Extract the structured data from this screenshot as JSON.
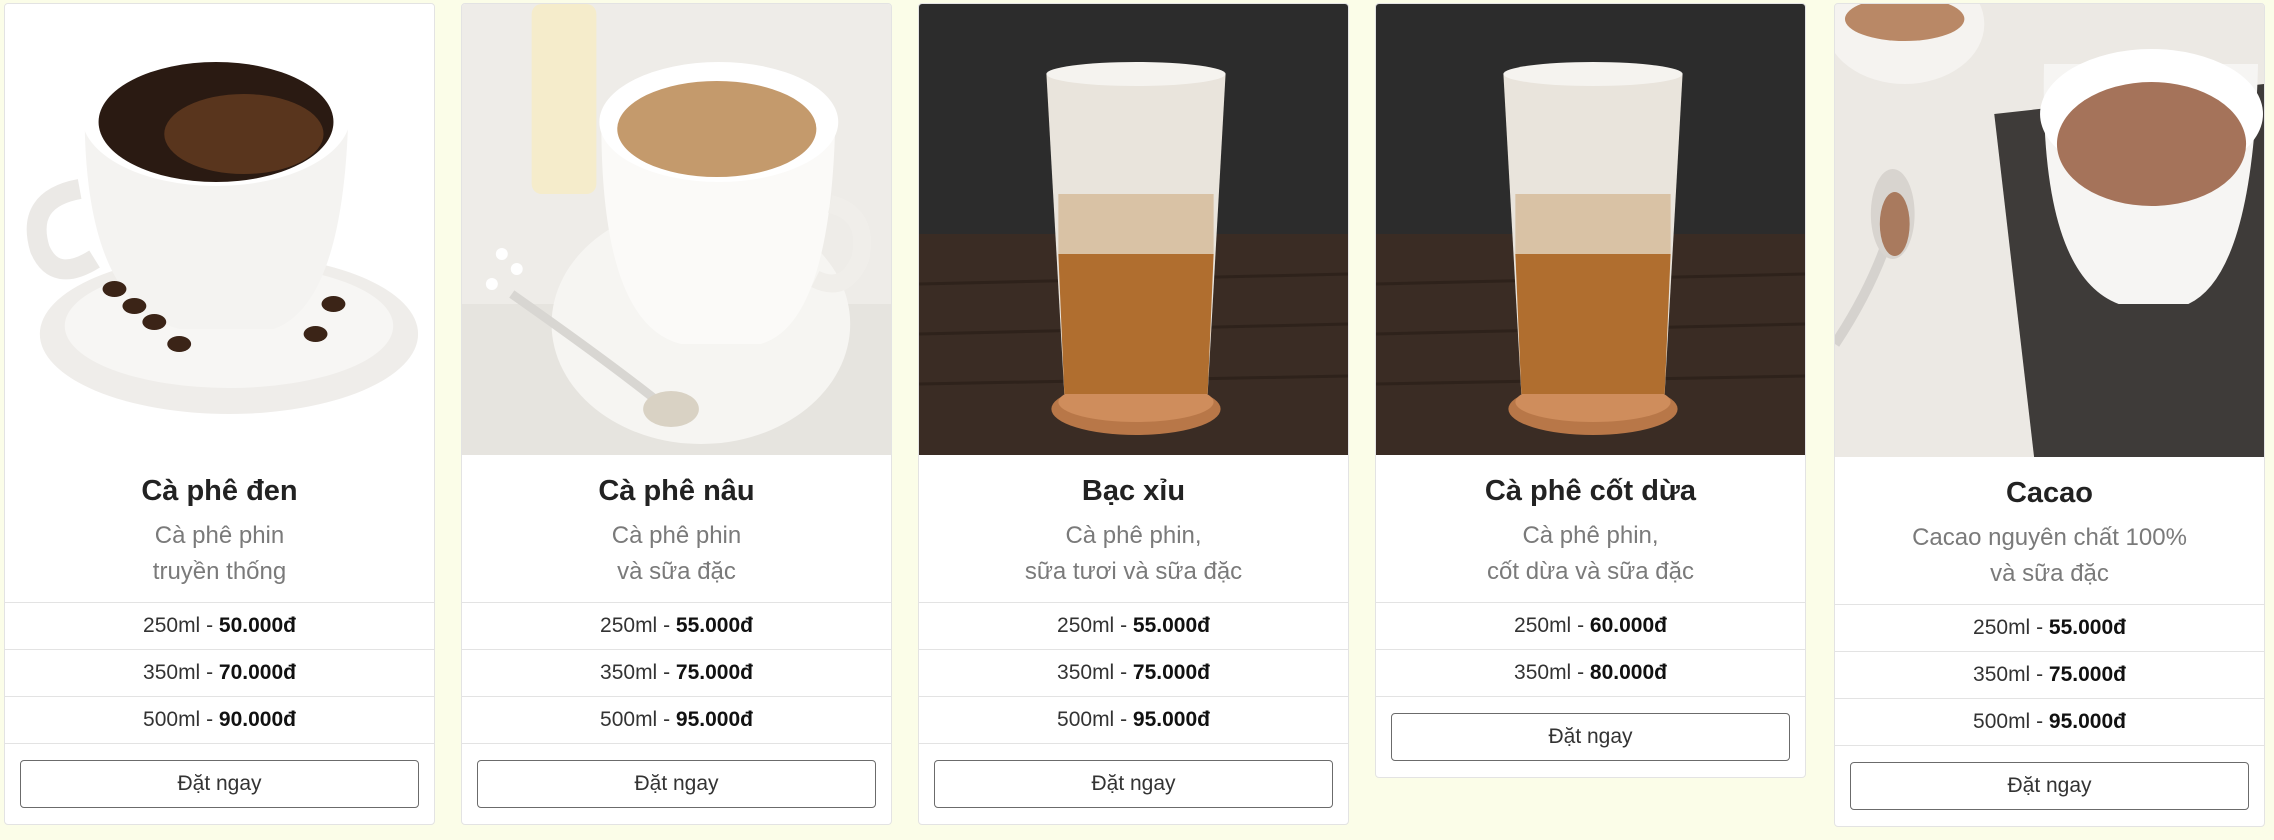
{
  "products": [
    {
      "name": "Cà phê đen",
      "desc1": "Cà phê phin",
      "desc2": "truyền thống",
      "prices": [
        {
          "size": "250ml",
          "price": "50.000đ"
        },
        {
          "size": "350ml",
          "price": "70.000đ"
        },
        {
          "size": "500ml",
          "price": "90.000đ"
        }
      ],
      "button": "Đặt ngay"
    },
    {
      "name": "Cà phê nâu",
      "desc1": "Cà phê phin",
      "desc2": "và sữa đặc",
      "prices": [
        {
          "size": "250ml",
          "price": "55.000đ"
        },
        {
          "size": "350ml",
          "price": "75.000đ"
        },
        {
          "size": "500ml",
          "price": "95.000đ"
        }
      ],
      "button": "Đặt ngay"
    },
    {
      "name": "Bạc xỉu",
      "desc1": "Cà phê phin,",
      "desc2": "sữa tươi và sữa đặc",
      "prices": [
        {
          "size": "250ml",
          "price": "55.000đ"
        },
        {
          "size": "350ml",
          "price": "75.000đ"
        },
        {
          "size": "500ml",
          "price": "95.000đ"
        }
      ],
      "button": "Đặt ngay"
    },
    {
      "name": "Cà phê cốt dừa",
      "desc1": "Cà phê phin,",
      "desc2": "cốt dừa và sữa đặc",
      "prices": [
        {
          "size": "250ml",
          "price": "60.000đ"
        },
        {
          "size": "350ml",
          "price": "80.000đ"
        }
      ],
      "button": "Đặt ngay"
    },
    {
      "name": "Cacao",
      "desc1": "Cacao nguyên chất 100%",
      "desc2": "và sữa đặc",
      "prices": [
        {
          "size": "250ml",
          "price": "55.000đ"
        },
        {
          "size": "350ml",
          "price": "75.000đ"
        },
        {
          "size": "500ml",
          "price": "95.000đ"
        }
      ],
      "button": "Đặt ngay"
    }
  ],
  "colors": {
    "background": "#fbfde8",
    "card": "#ffffff",
    "border": "#e3e3e3",
    "title": "#222222",
    "desc": "#7a7a7a"
  },
  "icons": [
    "black-coffee-image",
    "milk-coffee-image",
    "iced-latte-image",
    "coconut-coffee-image",
    "cacao-image"
  ]
}
